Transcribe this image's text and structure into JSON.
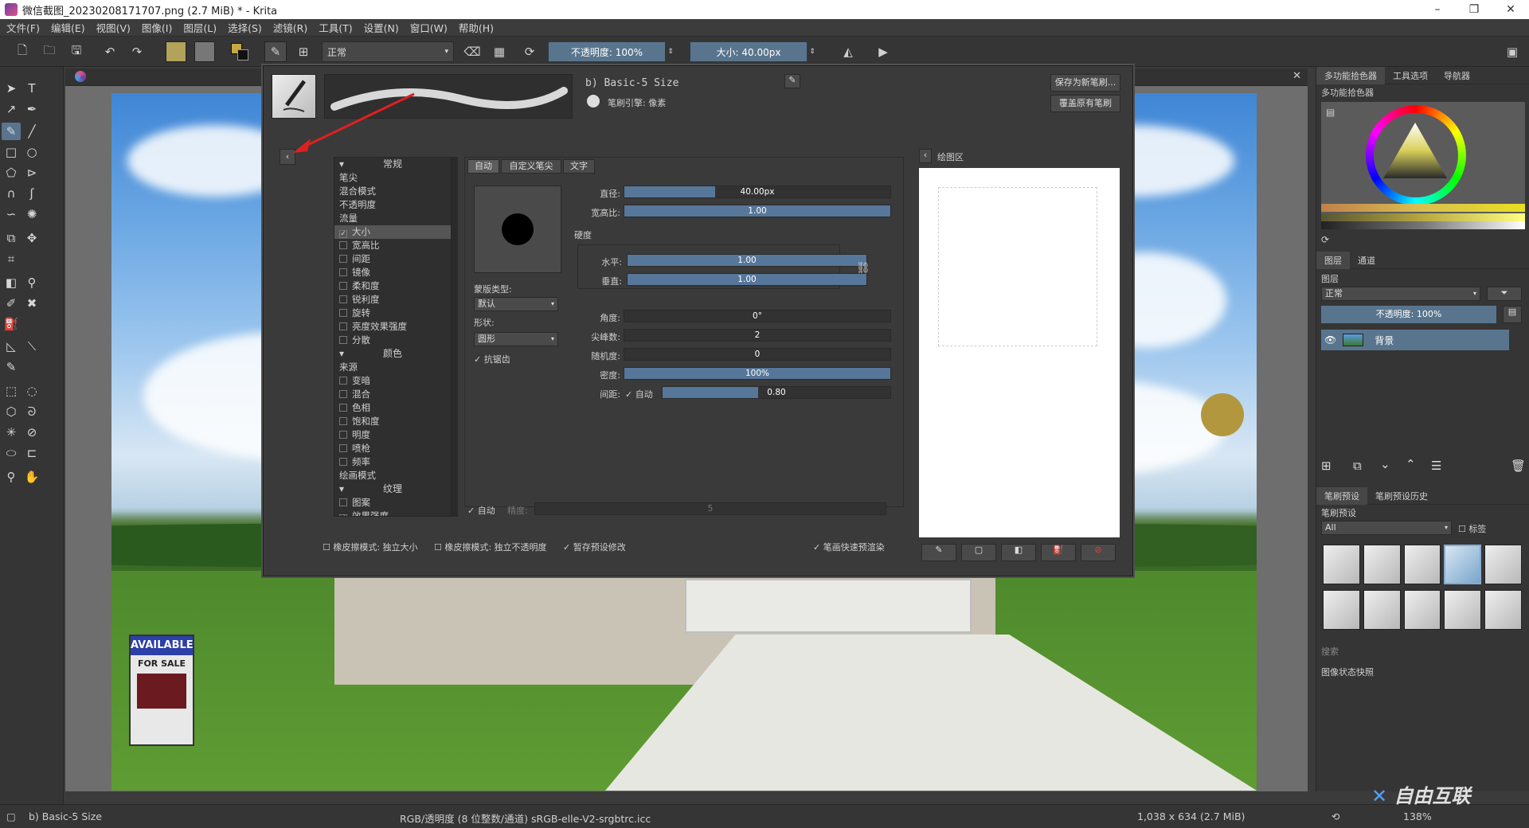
{
  "window": {
    "title": "微信截图_20230208171707.png (2.7 MiB)  * - Krita",
    "min": "–",
    "max": "❐",
    "close": "✕"
  },
  "menu": [
    "文件(F)",
    "编辑(E)",
    "视图(V)",
    "图像(I)",
    "图层(L)",
    "选择(S)",
    "滤镜(R)",
    "工具(T)",
    "设置(N)",
    "窗口(W)",
    "帮助(H)"
  ],
  "toolbar": {
    "blend_mode": "正常",
    "opacity_label": "不透明度: 100%",
    "size_label": "大小: 40.00px",
    "colors": {
      "fg": "#c8a843",
      "bg": "#7a7a7a"
    }
  },
  "brush_editor": {
    "preset_name": "b) Basic-5 Size",
    "engine_label": "笔刷引擎: 像素",
    "save_new": "保存为新笔刷...",
    "overwrite": "覆盖原有笔刷",
    "option_sections": [
      {
        "type": "hdr",
        "label": "常规"
      },
      {
        "type": "item",
        "label": "笔尖"
      },
      {
        "type": "item",
        "label": "混合模式"
      },
      {
        "type": "item",
        "label": "不透明度"
      },
      {
        "type": "item",
        "label": "流量"
      },
      {
        "type": "cb",
        "label": "大小",
        "checked": true
      },
      {
        "type": "cb",
        "label": "宽高比",
        "checked": false
      },
      {
        "type": "cb",
        "label": "间距",
        "checked": false
      },
      {
        "type": "cb",
        "label": "镜像",
        "checked": false
      },
      {
        "type": "cb",
        "label": "柔和度",
        "checked": false
      },
      {
        "type": "cb",
        "label": "锐利度",
        "checked": false
      },
      {
        "type": "cb",
        "label": "旋转",
        "checked": false
      },
      {
        "type": "cb",
        "label": "亮度效果强度",
        "checked": false
      },
      {
        "type": "cb",
        "label": "分散",
        "checked": false
      },
      {
        "type": "hdr",
        "label": "颜色"
      },
      {
        "type": "item",
        "label": "来源"
      },
      {
        "type": "cb",
        "label": "变暗",
        "checked": false
      },
      {
        "type": "cb",
        "label": "混合",
        "checked": false
      },
      {
        "type": "cb",
        "label": "色相",
        "checked": false
      },
      {
        "type": "cb",
        "label": "饱和度",
        "checked": false
      },
      {
        "type": "cb",
        "label": "明度",
        "checked": false
      },
      {
        "type": "cb",
        "label": "喷枪",
        "checked": false
      },
      {
        "type": "cb",
        "label": "频率",
        "checked": false
      },
      {
        "type": "item",
        "label": "绘画模式"
      },
      {
        "type": "hdr",
        "label": "纹理"
      },
      {
        "type": "cb",
        "label": "图案",
        "checked": false
      },
      {
        "type": "cb",
        "label": "效果强度",
        "checked": true
      }
    ],
    "tip_tabs": [
      "自动",
      "自定义笔尖",
      "文字"
    ],
    "mask_type_label": "蒙版类型:",
    "mask_type_value": "默认",
    "shape_label": "形状:",
    "shape_value": "圆形",
    "antialias_label": "抗锯齿",
    "params": {
      "diameter": {
        "label": "直径:",
        "value": "40.00px",
        "fill": 0.34
      },
      "ratio": {
        "label": "宽高比:",
        "value": "1.00",
        "fill": 1.0
      },
      "hardness_label": "硬度",
      "horizontal": {
        "label": "水平:",
        "value": "1.00",
        "fill": 1.0
      },
      "vertical": {
        "label": "垂直:",
        "value": "1.00",
        "fill": 1.0
      },
      "angle": {
        "label": "角度:",
        "value": "0°",
        "fill": 0
      },
      "spikes": {
        "label": "尖峰数:",
        "value": "2",
        "fill": 0
      },
      "randomness": {
        "label": "随机度:",
        "value": "0",
        "fill": 0
      },
      "density": {
        "label": "密度:",
        "value": "100%",
        "fill": 1.0
      },
      "spacing": {
        "label": "间距:",
        "auto": "自动",
        "value": "0.80",
        "fill": 0.42
      }
    },
    "precision_auto": "自动",
    "precision_label": "精度:",
    "precision_value": "5",
    "footer": {
      "eraser_size": "橡皮擦模式: 独立大小",
      "eraser_opacity": "橡皮擦模式: 独立不透明度",
      "temp_save": "暂存预设修改",
      "instant_preview": "笔画快速预渲染"
    },
    "scratchpad_label": "绘图区"
  },
  "docker": {
    "top_tabs": [
      "多功能拾色器",
      "工具选项",
      "导航器"
    ],
    "color_panel_title": "多功能拾色器",
    "layer_tabs": [
      "图层",
      "通道"
    ],
    "layers_title": "图层",
    "layer_blend": "正常",
    "layer_opacity": "不透明度:  100%",
    "layer_name": "背景",
    "preset_tabs": [
      "笔刷预设",
      "笔刷预设历史"
    ],
    "preset_title": "笔刷预设",
    "preset_filter": "All",
    "preset_tag": "标签",
    "search_label": "搜索",
    "snapshot_title": "图像状态快照"
  },
  "status": {
    "brush": "b) Basic-5 Size",
    "color_space": "RGB/透明度 (8 位整数/通道)  sRGB-elle-V2-srgbtrc.icc",
    "dimensions": "1,038 x 634 (2.7 MiB)",
    "zoom": "138%"
  },
  "sign": {
    "top": "AVAILABLE",
    "sub": "FOR SALE"
  },
  "watermark": "自由互联"
}
